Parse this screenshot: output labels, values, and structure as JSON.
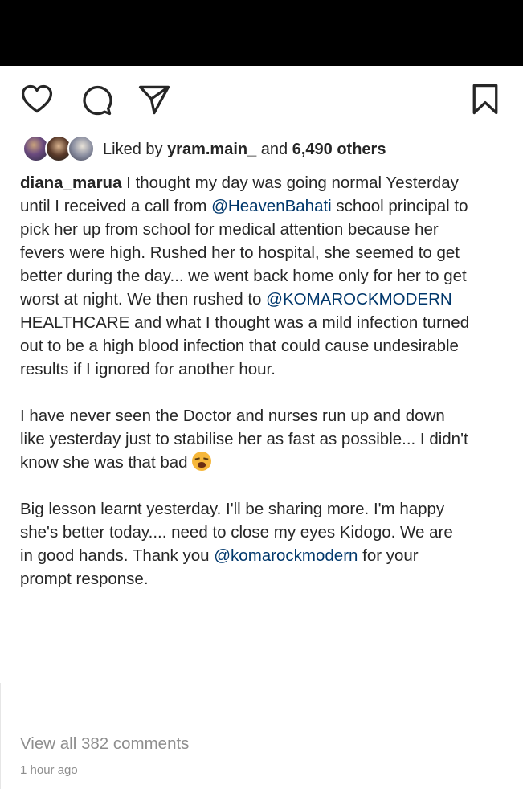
{
  "actions": {
    "like_icon": "heart-icon",
    "comment_icon": "comment-icon",
    "share_icon": "paper-plane-icon",
    "save_icon": "bookmark-icon"
  },
  "likes": {
    "prefix": "Liked by ",
    "user": "yram.main_",
    "joiner": " and ",
    "others": "6,490 others"
  },
  "caption": {
    "username": "diana_marua",
    "p1_a": " I thought my day was going normal Yesterday until I received a call from ",
    "mention1": "@HeavenBahati",
    "p1_b": " school principal to pick her up from school for medical attention because her fevers were high. Rushed her to hospital, she seemed to get better during the day... we went back home only for her to get worst at night. We then rushed to ",
    "mention2": "@KOMAROCKMODERN",
    "p1_c": " HEALTHCARE and what I thought was a mild infection turned out to be a high blood infection that could cause undesirable results if I ignored for another hour.",
    "p2": "I have never seen the Doctor and nurses run up and down like yesterday just to stabilise her as fast as possible... I didn't know she was that bad ",
    "p3_a": "Big lesson learnt yesterday. I'll be sharing more. I'm happy she's better today.... need to close my eyes Kidogo. We are in good hands. Thank you ",
    "mention3": "@komarockmodern",
    "p3_b": " for your prompt response."
  },
  "comments": {
    "view_all": "View all 382 comments"
  },
  "timestamp": "1 hour ago",
  "colors": {
    "mention": "#00376b",
    "text": "#262626",
    "muted": "#8e8e8e"
  }
}
